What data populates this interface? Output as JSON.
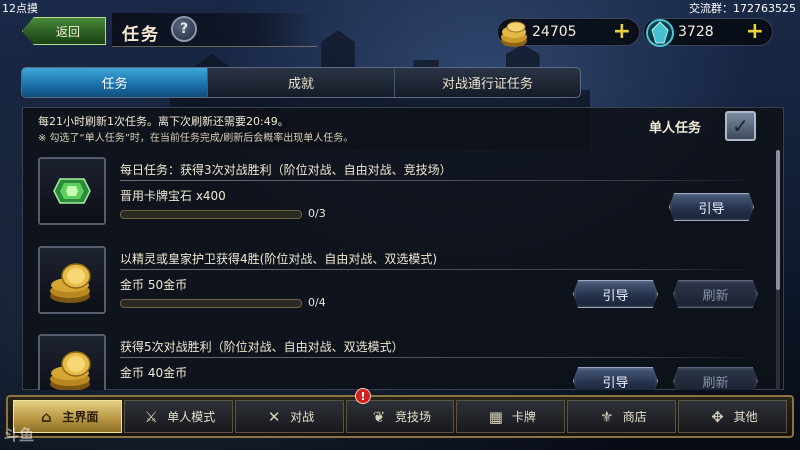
{
  "overlay": {
    "stream_label": "12点摸",
    "group_label": "交流群：172763525",
    "watermark": "斗鱼"
  },
  "header": {
    "back_label": "返回",
    "title": "任务",
    "help_symbol": "?"
  },
  "currency": {
    "gold": "24705",
    "gems": "3728",
    "plus_symbol": "+"
  },
  "tabs": [
    {
      "label": "任务",
      "active": true
    },
    {
      "label": "成就",
      "active": false
    },
    {
      "label": "对战通行证任务",
      "active": false
    }
  ],
  "notice": {
    "line1": "每21小时刷新1次任务。离下次刷新还需要20:49。",
    "line2": "※ 勾选了“单人任务”时，在当前任务完成/刷新后会概率出现单人任务。"
  },
  "solo_toggle": {
    "label": "单人任务",
    "checked": true,
    "check_symbol": "✓"
  },
  "quests": [
    {
      "description": "每日任务：获得3次对战胜利（阶位对战、自由对战、竞技场）",
      "reward": "晋用卡牌宝石 x400",
      "progress_text": "0/3",
      "progress": 0,
      "guide_label": "引导",
      "refresh_label": ""
    },
    {
      "description": "以精灵或皇家护卫获得4胜(阶位对战、自由对战、双选模式)",
      "reward": "金币 50金币",
      "progress_text": "0/4",
      "progress": 0,
      "guide_label": "引导",
      "refresh_label": "刷新"
    },
    {
      "description": "获得5次对战胜利（阶位对战、自由对战、双选模式）",
      "reward": "金币 40金币",
      "progress_text": "",
      "progress": 0,
      "guide_label": "引导",
      "refresh_label": "刷新"
    }
  ],
  "nav": [
    {
      "label": "主界面",
      "icon": "home-icon",
      "glyph": "⌂",
      "active": true
    },
    {
      "label": "单人模式",
      "icon": "solo-mode-icon",
      "glyph": "⚔",
      "active": false
    },
    {
      "label": "对战",
      "icon": "crossed-swords-icon",
      "glyph": "✕",
      "active": false
    },
    {
      "label": "竞技场",
      "icon": "arena-icon",
      "glyph": "❦",
      "active": false
    },
    {
      "label": "卡牌",
      "icon": "cards-icon",
      "glyph": "▦",
      "active": false
    },
    {
      "label": "商店",
      "icon": "shop-icon",
      "glyph": "⚜",
      "active": false
    },
    {
      "label": "其他",
      "icon": "other-icon",
      "glyph": "✥",
      "active": false
    }
  ],
  "arena_badge": "!",
  "colors": {
    "active_tab": "#1a6ea8",
    "active_nav": "#b69440",
    "gold_plus": "#e7d23a",
    "badge": "#d02020"
  }
}
